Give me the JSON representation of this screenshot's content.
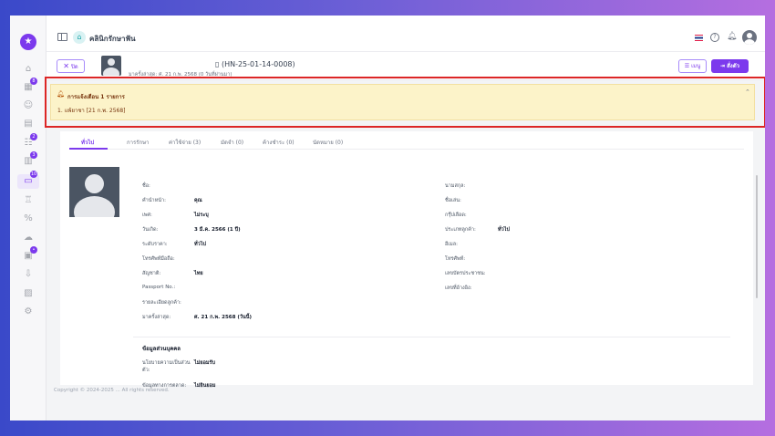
{
  "app": {
    "clinic_name": "คลินิกรักษาฟัน",
    "logo_icon": "star-logo",
    "colors": {
      "accent": "#7c3aed",
      "alert_bg": "#fcf3c9",
      "alert_outline": "#dc2626"
    }
  },
  "sidebar": {
    "items": [
      {
        "icon": "home-icon",
        "glyph": "⌂",
        "badge": ""
      },
      {
        "icon": "calendar-icon",
        "glyph": "▦",
        "badge": "8"
      },
      {
        "icon": "user-icon",
        "glyph": "☺",
        "badge": ""
      },
      {
        "icon": "clipboard-icon",
        "glyph": "▤",
        "badge": ""
      },
      {
        "icon": "queue-icon",
        "glyph": "☷",
        "badge": "2"
      },
      {
        "icon": "chart-icon",
        "glyph": "▥",
        "badge": "3"
      },
      {
        "icon": "wallet-icon",
        "glyph": "▭",
        "badge": "10"
      },
      {
        "icon": "tooth-icon",
        "glyph": "♖",
        "badge": ""
      },
      {
        "icon": "percent-icon",
        "glyph": "%",
        "badge": ""
      },
      {
        "icon": "cloud-icon",
        "glyph": "☁",
        "badge": ""
      },
      {
        "icon": "box-icon",
        "glyph": "▣",
        "badge": "•"
      },
      {
        "icon": "download-icon",
        "glyph": "⇩",
        "badge": ""
      },
      {
        "icon": "report-icon",
        "glyph": "▨",
        "badge": ""
      },
      {
        "icon": "settings-icon",
        "glyph": "⚙",
        "badge": ""
      }
    ]
  },
  "patient_header": {
    "close_label": "ปิด",
    "hn": "(HN-25-01-14-0008)",
    "last_visit": "มาครั้งล่าสุด: ศ. 21 ก.พ. 2568 (0 วันที่ผ่านมา)",
    "menu_label": "เมนู",
    "order_label": "สั่งตัว"
  },
  "alert": {
    "title": "การแจ้งเตือน 1 รายการ",
    "items": [
      "1. แพ้ยาชา [21 ก.พ. 2568]"
    ]
  },
  "tabs": [
    {
      "label": "ทั่วไป"
    },
    {
      "label": "การรักษา"
    },
    {
      "label": "ค่าใช้จ่าย (3)"
    },
    {
      "label": "มัดจำ (0)"
    },
    {
      "label": "ค้างชำระ (0)"
    },
    {
      "label": "นัดหมาย (0)"
    }
  ],
  "profile": {
    "left": [
      {
        "label": "ชื่อ:",
        "value": ""
      },
      {
        "label": "คำนำหน้า:",
        "value": "คุณ"
      },
      {
        "label": "เพศ:",
        "value": "ไม่ระบุ"
      },
      {
        "label": "วันเกิด:",
        "value": "3 มี.ค. 2566 (1 ปี)"
      },
      {
        "label": "ระดับราคา:",
        "value": "ทั่วไป"
      },
      {
        "label": "โทรศัพท์มือถือ:",
        "value": ""
      },
      {
        "label": "สัญชาติ:",
        "value": "ไทย"
      },
      {
        "label": "Passport No.:",
        "value": ""
      },
      {
        "label": "รายละเอียดลูกค้า:",
        "value": ""
      },
      {
        "label": "มาครั้งล่าสุด:",
        "value": "ศ. 21 ก.พ. 2568 (วันนี้)"
      }
    ],
    "right": [
      {
        "label": "นามสกุล:",
        "value": ""
      },
      {
        "label": "ชื่อเล่น:",
        "value": ""
      },
      {
        "label": "กรุ๊ปเลือด:",
        "value": ""
      },
      {
        "label": "ประเภทลูกค้า:",
        "value": "ทั่วไป"
      },
      {
        "label": "อีเมล:",
        "value": ""
      },
      {
        "label": "โทรศัพท์:",
        "value": ""
      },
      {
        "label": "เลขบัตรประชาชน:",
        "value": ""
      },
      {
        "label": "เลขที่อ้างอิง:",
        "value": ""
      }
    ]
  },
  "personal_section": {
    "title": "ข้อมูลส่วนบุคคล",
    "fields": [
      {
        "label": "นโยบายความเป็นส่วนตัว:",
        "value": "ไม่ยอมรับ"
      },
      {
        "label": "ข้อมูลทางการตลาด:",
        "value": "ไม่ยินยอม"
      }
    ]
  },
  "footer": {
    "text": "Copyright © 2024-2025 ... All rights reserved."
  }
}
